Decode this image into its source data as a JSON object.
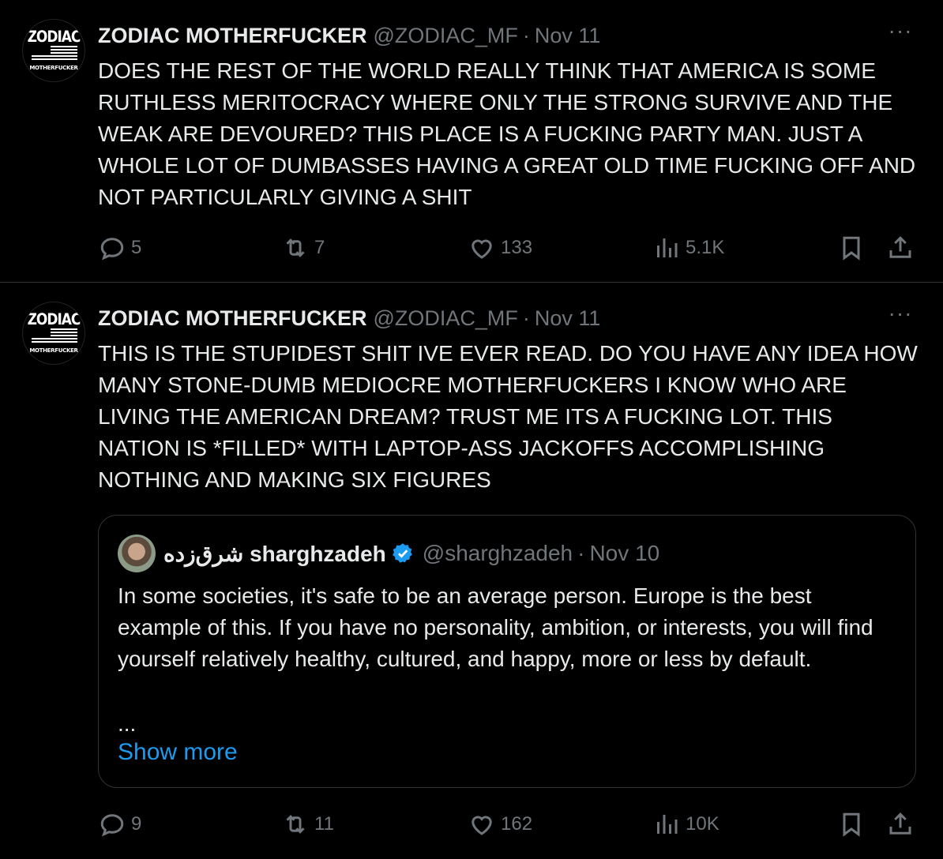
{
  "tweets": [
    {
      "author": {
        "name": "ZODIAC MOTHERFUCKER",
        "handle": "@ZODIAC_MF",
        "avatar_top_text": "ZODIAC",
        "avatar_bottom_text": "MOTHERFUCKER"
      },
      "separator": "·",
      "date": "Nov 11",
      "text": "DOES THE REST OF THE WORLD REALLY THINK THAT AMERICA IS SOME RUTHLESS MERITOCRACY WHERE ONLY THE STRONG SURVIVE AND THE WEAK ARE DEVOURED? THIS PLACE IS A FUCKING PARTY MAN. JUST A WHOLE LOT OF DUMBASSES HAVING A GREAT OLD TIME FUCKING OFF AND NOT PARTICULARLY GIVING A SHIT",
      "more_glyph": "···",
      "stats": {
        "replies": "5",
        "reposts": "7",
        "likes": "133",
        "views": "5.1K"
      }
    },
    {
      "author": {
        "name": "ZODIAC MOTHERFUCKER",
        "handle": "@ZODIAC_MF",
        "avatar_top_text": "ZODIAC",
        "avatar_bottom_text": "MOTHERFUCKER"
      },
      "separator": "·",
      "date": "Nov 11",
      "text": "THIS IS THE STUPIDEST SHIT IVE EVER READ. DO YOU HAVE ANY IDEA HOW MANY STONE-DUMB MEDIOCRE MOTHERFUCKERS I KNOW WHO ARE LIVING THE AMERICAN DREAM? TRUST ME ITS A FUCKING LOT. THIS NATION IS *FILLED* WITH LAPTOP-ASS JACKOFFS ACCOMPLISHING NOTHING AND MAKING SIX FIGURES",
      "more_glyph": "···",
      "quote": {
        "name": "شرق‌زده sharghzadeh",
        "handle": "@sharghzadeh",
        "separator": "·",
        "date": "Nov 10",
        "text": "In some societies, it's safe to be an average person. Europe is the best example of this. If you have no personality, ambition, or interests, you will find yourself relatively healthy, cultured, and happy, more or less by default.",
        "ellipsis": "...",
        "show_more": "Show more"
      },
      "stats": {
        "replies": "9",
        "reposts": "11",
        "likes": "162",
        "views": "10K"
      }
    }
  ],
  "colors": {
    "background": "#000000",
    "text": "#e7e9ea",
    "muted": "#71767b",
    "border": "#2f3336",
    "accent": "#1d9bf0"
  },
  "icons": [
    "reply-icon",
    "repost-icon",
    "like-icon",
    "views-icon",
    "bookmark-icon",
    "share-icon",
    "verified-badge-icon",
    "more-icon"
  ]
}
